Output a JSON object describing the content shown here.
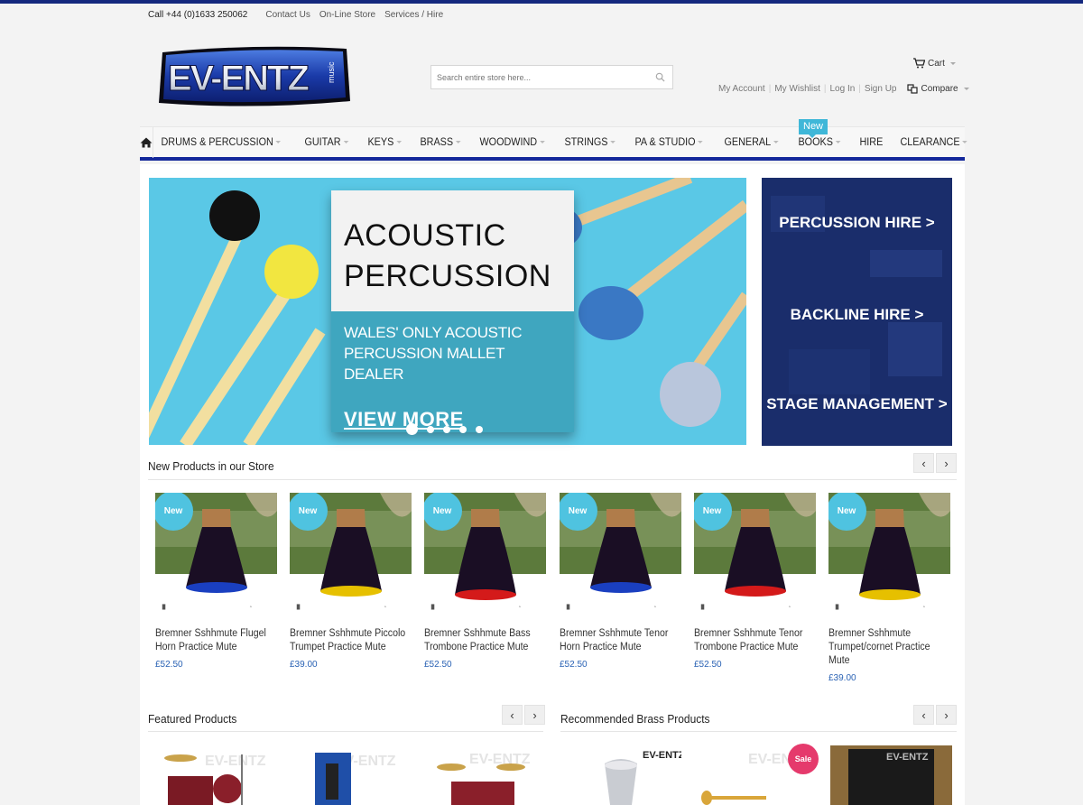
{
  "topbar": {
    "phone": "Call +44 (0)1633 250062",
    "links": [
      "Contact Us",
      "On-Line Store",
      "Services / Hire"
    ]
  },
  "logo": {
    "text": "EV-ENTZ",
    "sub": "music"
  },
  "search": {
    "placeholder": "Search entire store here..."
  },
  "header": {
    "cart_label": "Cart",
    "account_links": [
      "My Account",
      "My Wishlist",
      "Log In",
      "Sign Up"
    ],
    "compare_label": "Compare"
  },
  "nav": {
    "items": [
      "DRUMS & PERCUSSION",
      "GUITAR",
      "KEYS",
      "BRASS",
      "WOODWIND",
      "STRINGS",
      "PA & STUDIO",
      "GENERAL",
      "BOOKS",
      "HIRE",
      "CLEARANCE"
    ],
    "hire_tag": "New"
  },
  "banner": {
    "title_line1": "ACOUSTIC",
    "title_line2": "PERCUSSION",
    "subtitle": "WALES' ONLY ACOUSTIC PERCUSSION MALLET DEALER",
    "cta": "VIEW MORE",
    "slide_count": 5,
    "active_slide": 1
  },
  "hire_panel": {
    "links": [
      "PERCUSSION HIRE >",
      "BACKLINE HIRE >",
      "STAGE MANAGEMENT >"
    ]
  },
  "new_products": {
    "title": "New Products in our Store",
    "items": [
      {
        "badge": "New",
        "name": "Bremner Sshhmute Flugel Horn Practice Mute",
        "price": "£52.50",
        "ring": "#1a3fc0"
      },
      {
        "badge": "New",
        "name": "Bremner Sshhmute Piccolo Trumpet Practice Mute",
        "price": "£39.00",
        "ring": "#e6c000"
      },
      {
        "badge": "New",
        "name": "Bremner Sshhmute Bass Trombone Practice Mute",
        "price": "£52.50",
        "ring": "#d41a1a"
      },
      {
        "badge": "New",
        "name": "Bremner Sshhmute Tenor Horn Practice Mute",
        "price": "£52.50",
        "ring": "#1a3fc0"
      },
      {
        "badge": "New",
        "name": "Bremner Sshhmute Tenor Trombone Practice Mute",
        "price": "£52.50",
        "ring": "#d41a1a"
      },
      {
        "badge": "New",
        "name": "Bremner Sshhmute Trumpet/cornet Practice Mute",
        "price": "£39.00",
        "ring": "#e6c000"
      }
    ]
  },
  "featured": {
    "title": "Featured Products"
  },
  "recommended": {
    "title": "Recommended Brass Products",
    "sale_badge": "Sale"
  },
  "arrows": {
    "prev": "‹",
    "next": "›"
  },
  "colors": {
    "brand_blue": "#14287e",
    "accent_cyan": "#4fc3e0",
    "price_blue": "#2a62b4",
    "sale_pink": "#e53a6c"
  }
}
